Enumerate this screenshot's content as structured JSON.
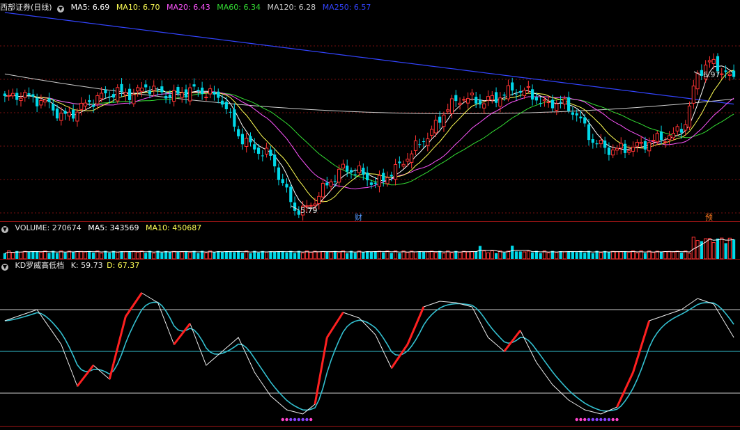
{
  "header_main": {
    "stock": "西部证券(日线)",
    "ma5": "MA5: 6.69",
    "ma10": "MA10: 6.70",
    "ma20": "MA20: 6.43",
    "ma60": "MA60: 6.34",
    "ma120": "MA120: 6.28",
    "ma250": "MA250: 6.57",
    "dropdown_icon": "chevron-down-icon"
  },
  "header_volume": {
    "volume": "VOLUME: 270674",
    "ma5": "MA5: 343569",
    "ma10": "MA10: 450687"
  },
  "header_kd": {
    "name": "KD罗威高低档",
    "k": "K: 59.73",
    "d": "D: 67.37"
  },
  "annotations": {
    "high_label": "6.97",
    "low_label": "5.79",
    "marker_cai": "财",
    "marker_yu": "预"
  },
  "colors": {
    "up": "#ff3333",
    "down": "#00d8e8",
    "ma5": "#ffffff",
    "ma10": "#ffff55",
    "ma20": "#ff55ff",
    "ma60": "#33dd33",
    "ma120": "#cccccc",
    "ma250": "#3344ff",
    "k_line": "#ff2020",
    "d_line": "#33c0d0",
    "grid": "#7a1010"
  },
  "chart_data": [
    {
      "type": "candlestick",
      "title": "西部证券(日线)",
      "marked_high": 6.97,
      "marked_low": 5.79,
      "series": [
        {
          "name": "MA5",
          "last": 6.69
        },
        {
          "name": "MA10",
          "last": 6.7
        },
        {
          "name": "MA20",
          "last": 6.43
        },
        {
          "name": "MA60",
          "last": 6.34
        },
        {
          "name": "MA120",
          "last": 6.28
        },
        {
          "name": "MA250",
          "last": 6.57
        }
      ],
      "ylim": [
        5.75,
        7.45
      ]
    },
    {
      "type": "bar",
      "title": "VOLUME",
      "series": [
        {
          "name": "VOLUME",
          "last": 270674
        },
        {
          "name": "MA5",
          "last": 343569
        },
        {
          "name": "MA10",
          "last": 450687
        }
      ]
    },
    {
      "type": "line",
      "title": "KD罗威高低档",
      "series": [
        {
          "name": "K",
          "last": 59.73
        },
        {
          "name": "D",
          "last": 67.37
        }
      ],
      "ylim": [
        0,
        100
      ]
    }
  ]
}
